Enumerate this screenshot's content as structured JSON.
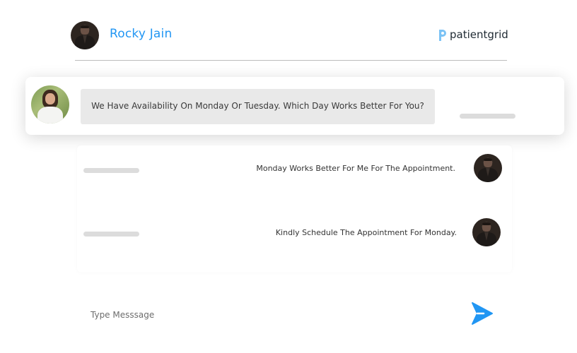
{
  "header": {
    "contact_name": "Rocky Jain",
    "brand": "patientgrid",
    "accent_color": "#2196f3"
  },
  "messages": [
    {
      "sender": "doctor",
      "text": "We Have Availability On Monday Or Tuesday. Which Day Works Better For You?"
    },
    {
      "sender": "patient",
      "text": "Monday Works Better For Me For The Appointment."
    },
    {
      "sender": "patient",
      "text": "Kindly Schedule The Appointment For Monday."
    }
  ],
  "composer": {
    "placeholder": "Type Messsage",
    "send_icon": "send-arrow-icon"
  }
}
